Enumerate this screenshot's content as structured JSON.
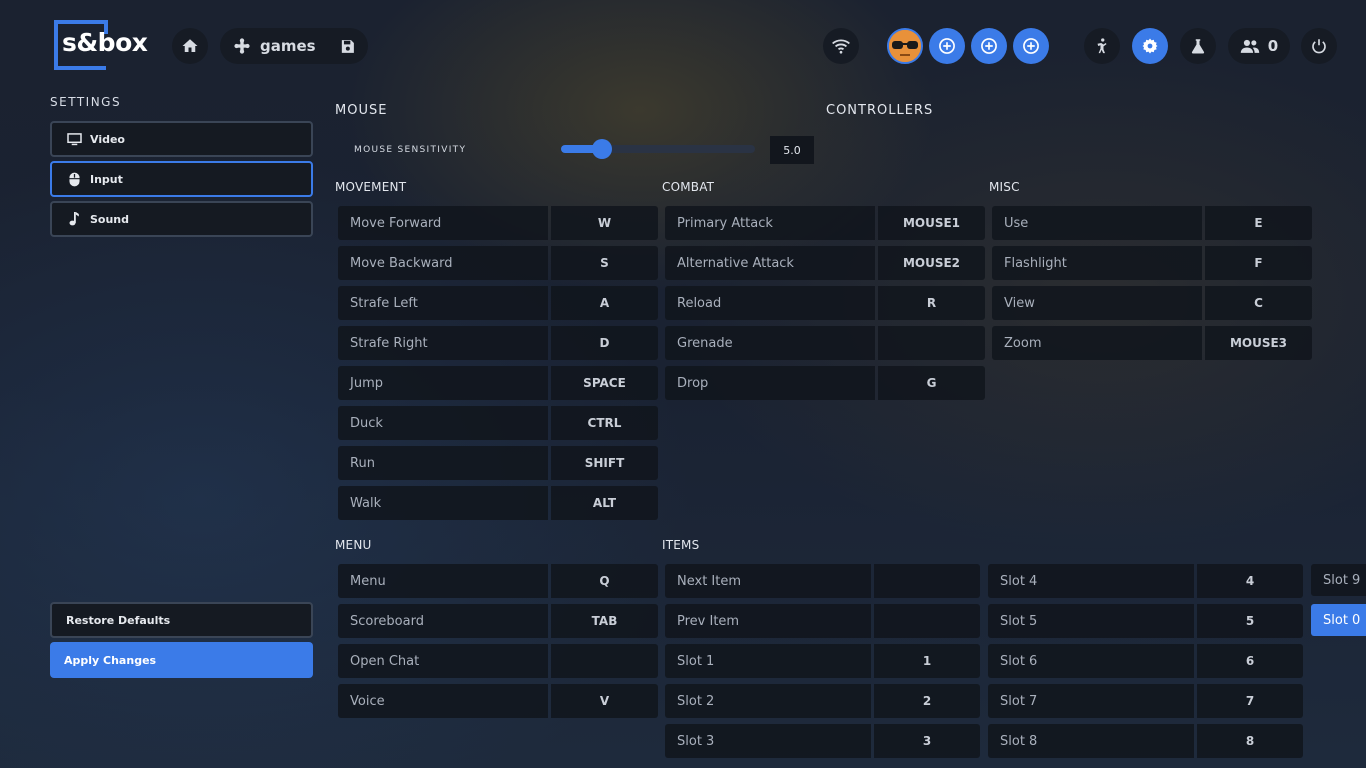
{
  "logo": {
    "text": "s&box"
  },
  "topbar": {
    "games_label": "games",
    "friends_count": "0"
  },
  "sidebar": {
    "title": "SETTINGS",
    "items": [
      {
        "label": "Video",
        "icon": "monitor-icon"
      },
      {
        "label": "Input",
        "icon": "mouse-icon",
        "active": true
      },
      {
        "label": "Sound",
        "icon": "music-note-icon"
      }
    ],
    "restore_label": "Restore Defaults",
    "apply_label": "Apply Changes"
  },
  "mouse": {
    "title": "MOUSE",
    "sensitivity_label": "MOUSE SENSITIVITY",
    "sensitivity_value": "5.0",
    "sensitivity_fraction": 0.21
  },
  "controllers": {
    "title": "CONTROLLERS"
  },
  "movement": {
    "title": "MOVEMENT",
    "binds": [
      {
        "action": "Move Forward",
        "key": "W"
      },
      {
        "action": "Move Backward",
        "key": "S"
      },
      {
        "action": "Strafe Left",
        "key": "A"
      },
      {
        "action": "Strafe Right",
        "key": "D"
      },
      {
        "action": "Jump",
        "key": "SPACE"
      },
      {
        "action": "Duck",
        "key": "CTRL"
      },
      {
        "action": "Run",
        "key": "SHIFT"
      },
      {
        "action": "Walk",
        "key": "ALT"
      }
    ]
  },
  "combat": {
    "title": "COMBAT",
    "binds": [
      {
        "action": "Primary Attack",
        "key": "MOUSE1"
      },
      {
        "action": "Alternative Attack",
        "key": "MOUSE2"
      },
      {
        "action": "Reload",
        "key": "R"
      },
      {
        "action": "Grenade",
        "key": ""
      },
      {
        "action": "Drop",
        "key": "G"
      }
    ]
  },
  "misc": {
    "title": "MISC",
    "binds": [
      {
        "action": "Use",
        "key": "E"
      },
      {
        "action": "Flashlight",
        "key": "F"
      },
      {
        "action": "View",
        "key": "C"
      },
      {
        "action": "Zoom",
        "key": "MOUSE3"
      }
    ]
  },
  "menu": {
    "title": "MENU",
    "binds": [
      {
        "action": "Menu",
        "key": "Q"
      },
      {
        "action": "Scoreboard",
        "key": "TAB"
      },
      {
        "action": "Open Chat",
        "key": ""
      },
      {
        "action": "Voice",
        "key": "V"
      }
    ]
  },
  "items": {
    "title": "ITEMS",
    "col1": [
      {
        "action": "Next Item",
        "key": ""
      },
      {
        "action": "Prev Item",
        "key": ""
      },
      {
        "action": "Slot 1",
        "key": "1"
      },
      {
        "action": "Slot 2",
        "key": "2"
      },
      {
        "action": "Slot 3",
        "key": "3"
      }
    ],
    "col2": [
      {
        "action": "Slot 4",
        "key": "4"
      },
      {
        "action": "Slot 5",
        "key": "5"
      },
      {
        "action": "Slot 6",
        "key": "6"
      },
      {
        "action": "Slot 7",
        "key": "7"
      },
      {
        "action": "Slot 8",
        "key": "8"
      }
    ],
    "col3": [
      {
        "action": "Slot 9",
        "key": ""
      },
      {
        "action": "Slot 0",
        "key": "",
        "highlighted": true
      }
    ]
  },
  "colors": {
    "accent": "#3b7be8",
    "panel": "#161b24",
    "avatar_bg": "#e8913a"
  }
}
